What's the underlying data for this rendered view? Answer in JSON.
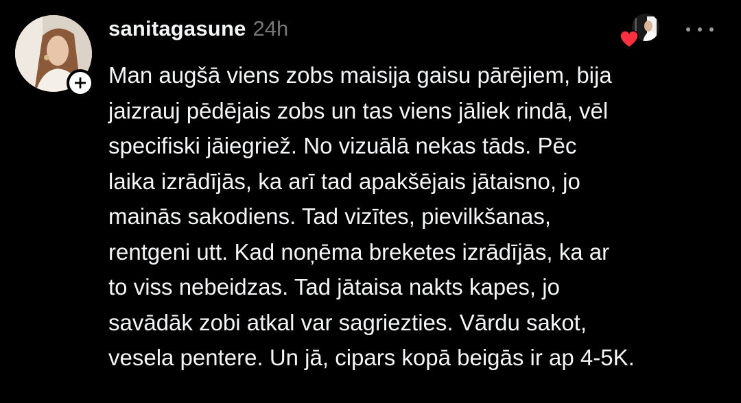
{
  "post": {
    "username": "sanitagasune",
    "timestamp": "24h",
    "lines": [
      "Man augšā viens zobs maisija gaisu pārējiem, bija",
      "jaizrauj pēdējais zobs un tas viens jāliek rindā, vēl",
      "specifiski jāiegriež. No vizuālā nekas tāds. Pēc",
      "laika izrādījās, ka arī tad apakšējais jātaisno, jo",
      "mainās sakodiens. Tad vizītes, pievilkšanas,",
      "rentgeni utt. Kad noņēma breketes izrādījās, ka ar",
      "to viss nebeidzas. Tad jātaisa nakts kapes, jo",
      "savādāk zobi atkal var sagriezties. Vārdu sakot,",
      "vesela pentere. Un jā, cipars kopā beigās ir ap 4-5K."
    ]
  },
  "icons": {
    "follow": "plus-icon",
    "like": "heart-icon",
    "menu": "more-icon"
  },
  "colors": {
    "background": "#000000",
    "text": "#f3f5f7",
    "muted": "#777777",
    "heart": "#ff3040"
  }
}
